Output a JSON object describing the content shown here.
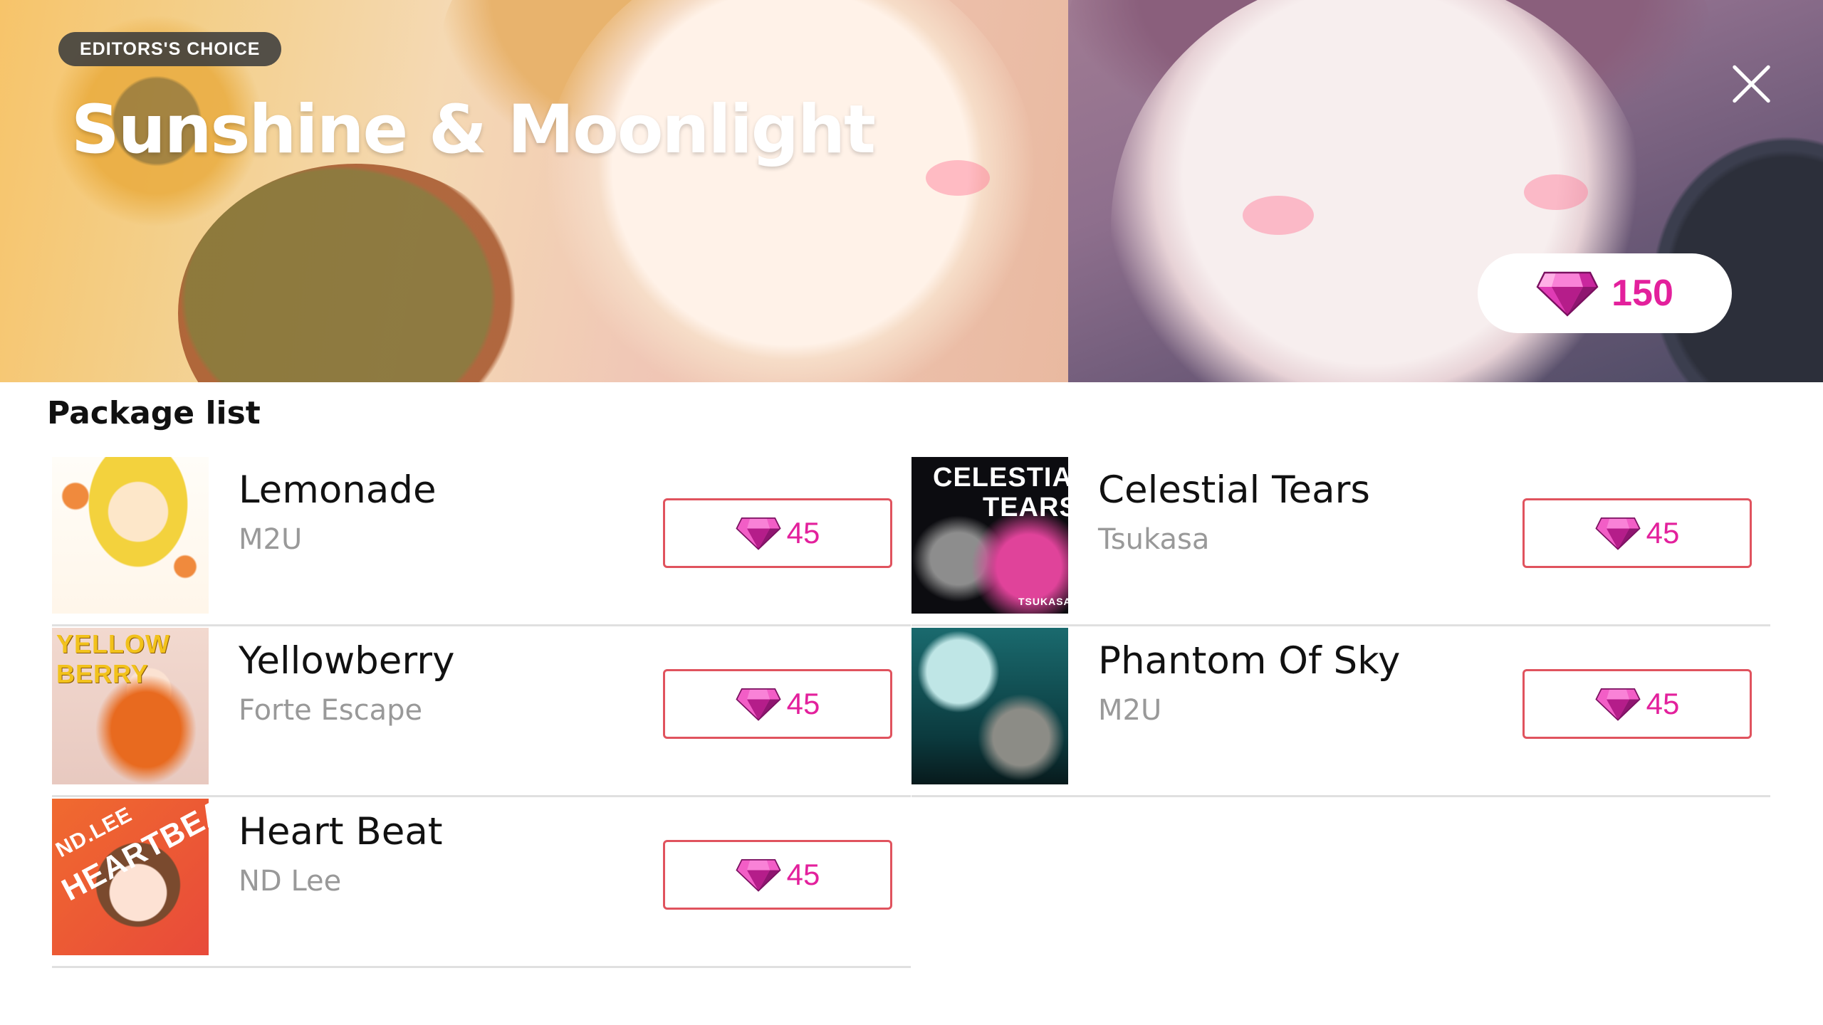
{
  "banner": {
    "badge": "EDITORS'S CHOICE",
    "title": "Sunshine & Moonlight",
    "price": "150"
  },
  "colors": {
    "accent_pink": "#e3209c",
    "button_border": "#e0535e",
    "divider": "#e0e0e0",
    "author_gray": "#999999"
  },
  "section_title": "Package list",
  "packages": [
    {
      "title": "Lemonade",
      "author": "M2U",
      "price": "45"
    },
    {
      "title": "Celestial Tears",
      "author": "Tsukasa",
      "price": "45",
      "cover_text": [
        "CELESTIAL",
        "TEARS",
        "TSUKASA"
      ]
    },
    {
      "title": "Yellowberry",
      "author": "Forte Escape",
      "price": "45",
      "cover_text": [
        "YELLOW",
        "BERRY"
      ]
    },
    {
      "title": "Phantom Of Sky",
      "author": "M2U",
      "price": "45"
    },
    {
      "title": "Heart Beat",
      "author": "ND Lee",
      "price": "45",
      "cover_text": [
        "ND.LEE",
        "HEARTBEAT"
      ]
    }
  ],
  "icons": {
    "close": "close-icon",
    "currency": "gem-icon"
  }
}
